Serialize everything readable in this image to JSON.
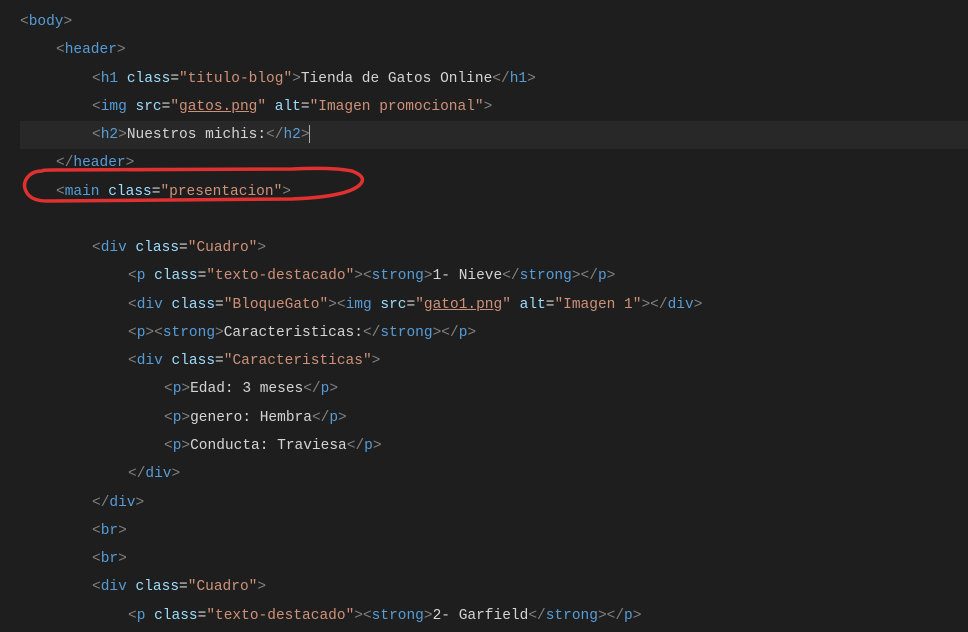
{
  "code": {
    "line1": {
      "tag": "body"
    },
    "line2": {
      "tag": "header"
    },
    "line3": {
      "tag": "h1",
      "attr": "class",
      "val": "titulo-blog",
      "text": "Tienda de Gatos Online",
      "closeTag": "h1"
    },
    "line4": {
      "tag": "img",
      "attr1": "src",
      "val1": "gatos.png",
      "attr2": "alt",
      "val2": "Imagen promocional"
    },
    "line5": {
      "tag": "h2",
      "text": "Nuestros michis:",
      "closeTag": "h2"
    },
    "line6": {
      "tag": "header"
    },
    "line7": {
      "tag": "main",
      "attr": "class",
      "val": "presentacion"
    },
    "line9": {
      "tag": "div",
      "attr": "class",
      "val": "Cuadro"
    },
    "line10": {
      "tag": "p",
      "attr": "class",
      "val": "texto-destacado",
      "innerTag": "strong",
      "text": "1- Nieve",
      "closeInner": "strong",
      "closeTag": "p"
    },
    "line11": {
      "tag": "div",
      "attr": "class",
      "val": "BloqueGato",
      "innerTag": "img",
      "attr1": "src",
      "val1": "gato1.png",
      "attr2": "alt",
      "val2": "Imagen 1",
      "closeTag": "div"
    },
    "line12": {
      "tag": "p",
      "innerTag": "strong",
      "text": "Caracteristicas:",
      "closeInner": "strong",
      "closeTag": "p"
    },
    "line13": {
      "tag": "div",
      "attr": "class",
      "val": "Caracteristicas"
    },
    "line14": {
      "tag": "p",
      "text": "Edad: 3 meses",
      "closeTag": "p"
    },
    "line15": {
      "tag": "p",
      "text": "genero: Hembra",
      "closeTag": "p"
    },
    "line16": {
      "tag": "p",
      "text": "Conducta: Traviesa",
      "closeTag": "p"
    },
    "line17": {
      "tag": "div"
    },
    "line18": {
      "tag": "div"
    },
    "line19": {
      "tag": "br"
    },
    "line20": {
      "tag": "br"
    },
    "line21": {
      "tag": "div",
      "attr": "class",
      "val": "Cuadro"
    },
    "line22": {
      "tag": "p",
      "attr": "class",
      "val": "texto-destacado",
      "innerTag": "strong",
      "text": "2- Garfield",
      "closeInner": "strong",
      "closeTag": "p"
    }
  }
}
